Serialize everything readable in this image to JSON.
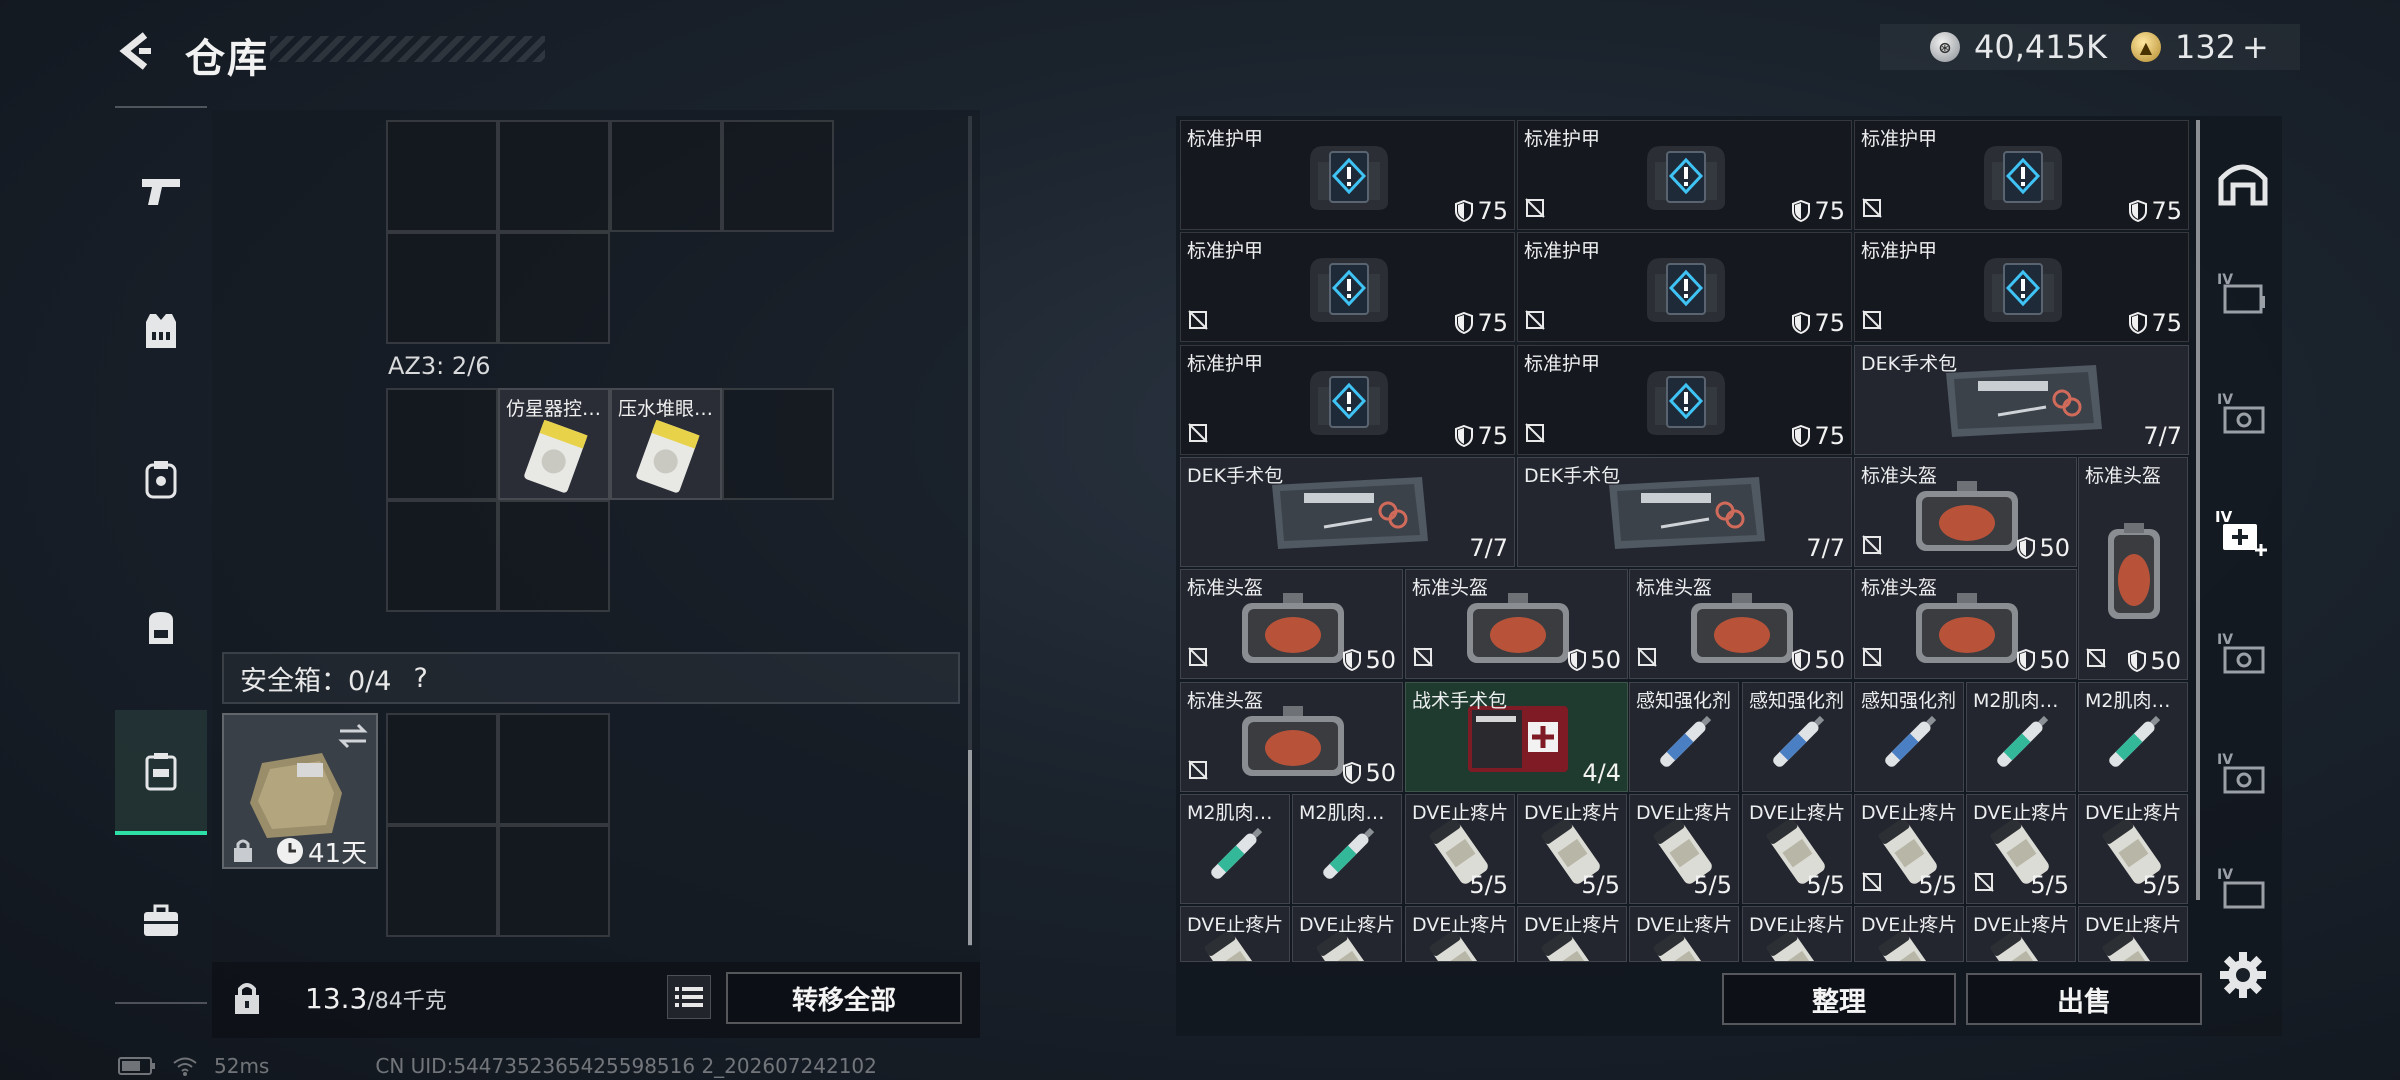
{
  "header": {
    "title": "仓库",
    "silver_amount": "40,415K",
    "gold_amount": "132",
    "gold_plus": "+"
  },
  "nav": {
    "items": [
      "weapons",
      "armor",
      "rig",
      "backpack",
      "container",
      "toolbox"
    ],
    "active": "container"
  },
  "left": {
    "az3_label": "AZ3: 2/6",
    "slot_items": [
      "仿星器控…",
      "压水堆眼…"
    ],
    "safe_box_label": "安全箱：0/4",
    "safe_box_help": "?",
    "safe_box_timer": "41天",
    "weight_current": "13.3",
    "weight_max": "/84千克",
    "transfer_all": "转移全部"
  },
  "right": {
    "items": [
      {
        "label": "标准护甲",
        "value": "75",
        "kind": "armor",
        "nodur": false
      },
      {
        "label": "标准护甲",
        "value": "75",
        "kind": "armor",
        "nodur": true
      },
      {
        "label": "标准护甲",
        "value": "75",
        "kind": "armor",
        "nodur": true
      },
      {
        "label": "标准护甲",
        "value": "75",
        "kind": "armor",
        "nodur": true
      },
      {
        "label": "标准护甲",
        "value": "75",
        "kind": "armor",
        "nodur": true
      },
      {
        "label": "标准护甲",
        "value": "75",
        "kind": "armor",
        "nodur": true
      },
      {
        "label": "标准护甲",
        "value": "75",
        "kind": "armor",
        "nodur": true
      },
      {
        "label": "标准护甲",
        "value": "75",
        "kind": "armor",
        "nodur": true
      },
      {
        "label": "DEK手术包",
        "value": "7/7",
        "kind": "medkit"
      },
      {
        "label": "DEK手术包",
        "value": "7/7",
        "kind": "medkit"
      },
      {
        "label": "DEK手术包",
        "value": "7/7",
        "kind": "medkit"
      },
      {
        "label": "标准头盔",
        "value": "50",
        "kind": "helmet",
        "nodur": true
      },
      {
        "label": "标准头盔",
        "value": "50",
        "kind": "helmet-tall",
        "nodur": true
      },
      {
        "label": "标准头盔",
        "value": "50",
        "kind": "helmet",
        "nodur": true
      },
      {
        "label": "标准头盔",
        "value": "50",
        "kind": "helmet",
        "nodur": true
      },
      {
        "label": "标准头盔",
        "value": "50",
        "kind": "helmet",
        "nodur": true
      },
      {
        "label": "标准头盔",
        "value": "50",
        "kind": "helmet",
        "nodur": true
      },
      {
        "label": "标准头盔",
        "value": "50",
        "kind": "helmet",
        "nodur": true
      },
      {
        "label": "战术手术包",
        "value": "4/4",
        "kind": "tac-kit"
      },
      {
        "label": "感知强化剂",
        "value": "",
        "kind": "injector-blue"
      },
      {
        "label": "感知强化剂",
        "value": "",
        "kind": "injector-blue"
      },
      {
        "label": "感知强化剂",
        "value": "",
        "kind": "injector-blue"
      },
      {
        "label": "M2肌肉…",
        "value": "",
        "kind": "injector-green"
      },
      {
        "label": "M2肌肉…",
        "value": "",
        "kind": "injector-green"
      },
      {
        "label": "M2肌肉…",
        "value": "",
        "kind": "injector-green"
      },
      {
        "label": "M2肌肉…",
        "value": "",
        "kind": "injector-green"
      },
      {
        "label": "DVE止疼片",
        "value": "5/5",
        "kind": "pills"
      },
      {
        "label": "DVE止疼片",
        "value": "5/5",
        "kind": "pills"
      },
      {
        "label": "DVE止疼片",
        "value": "5/5",
        "kind": "pills"
      },
      {
        "label": "DVE止疼片",
        "value": "5/5",
        "kind": "pills"
      },
      {
        "label": "DVE止疼片",
        "value": "5/5",
        "kind": "pills",
        "nodur": true
      },
      {
        "label": "DVE止疼片",
        "value": "5/5",
        "kind": "pills",
        "nodur": true
      },
      {
        "label": "DVE止疼片",
        "value": "5/5",
        "kind": "pills"
      },
      {
        "label": "DVE止疼片",
        "value": "",
        "kind": "pills"
      },
      {
        "label": "DVE止疼片",
        "value": "",
        "kind": "pills"
      },
      {
        "label": "DVE止疼片",
        "value": "",
        "kind": "pills"
      },
      {
        "label": "DVE止疼片",
        "value": "",
        "kind": "pills"
      },
      {
        "label": "DVE止疼片",
        "value": "",
        "kind": "pills"
      },
      {
        "label": "DVE止疼片",
        "value": "",
        "kind": "pills"
      },
      {
        "label": "DVE止疼片",
        "value": "",
        "kind": "pills"
      },
      {
        "label": "DVE止疼片",
        "value": "",
        "kind": "pills"
      },
      {
        "label": "DVE止疼片",
        "value": "",
        "kind": "pills"
      }
    ],
    "sort_label": "整理",
    "sell_label": "出售"
  },
  "right_tabs": [
    "safehouse",
    "IV-storage-1",
    "IV-storage-2",
    "IV-medical",
    "IV-storage-3",
    "IV-storage-4",
    "IV-storage-5"
  ],
  "status": {
    "ping": "52ms",
    "uid": "CN UID:5447352365425598516 2_202607242102"
  }
}
